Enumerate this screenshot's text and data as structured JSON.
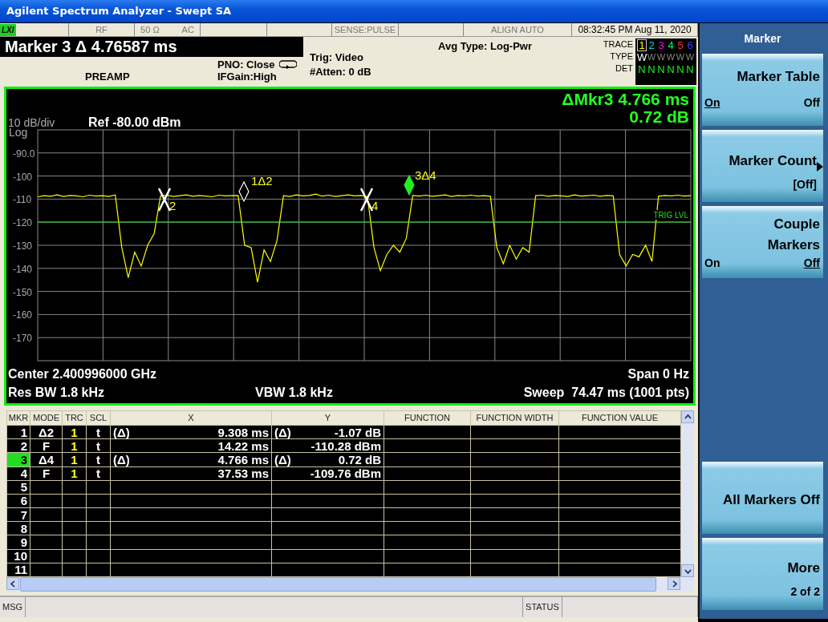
{
  "window": {
    "title": "Agilent Spectrum Analyzer - Swept SA"
  },
  "status_row": {
    "badge": "LXI",
    "rf": "RF",
    "impedance": "50 Ω",
    "coupling": "AC",
    "sense": "SENSE:PULSE",
    "align": "ALIGN AUTO",
    "datetime": "08:32:45 PM Aug 11, 2020"
  },
  "header": {
    "active_function": "Marker 3 Δ 4.76587 ms",
    "preamp": "PREAMP",
    "pno": "PNO: Close",
    "ifgain": "IFGain:High",
    "trig": "Trig: Video",
    "atten": "#Atten: 0 dB",
    "avg_type": "Avg Type: Log-Pwr"
  },
  "trace_panel": {
    "labels": [
      "TRACE",
      "TYPE",
      "DET"
    ],
    "traces": [
      {
        "number": "1",
        "color": "#ffff00",
        "selected": true,
        "type": "W",
        "det": "N"
      },
      {
        "number": "2",
        "color": "#00e0e0",
        "selected": false,
        "type": "W",
        "det": "N"
      },
      {
        "number": "3",
        "color": "#ff00ff",
        "selected": false,
        "type": "W",
        "det": "N"
      },
      {
        "number": "4",
        "color": "#00ff80",
        "selected": false,
        "type": "W",
        "det": "N"
      },
      {
        "number": "5",
        "color": "#ff3030",
        "selected": false,
        "type": "W",
        "det": "N"
      },
      {
        "number": "6",
        "color": "#4040ff",
        "selected": false,
        "type": "W",
        "det": "N"
      }
    ]
  },
  "graph": {
    "delta_readout": "ΔMkr3 4.766 ms",
    "delta_value": "0.72 dB",
    "scale": "10 dB/div",
    "ref": "Ref -80.00 dBm",
    "scale_type": "Log",
    "chart_data": {
      "type": "line",
      "grid": true,
      "ylim": [
        -180,
        -80
      ],
      "yticks": [
        {
          "value": -90,
          "label": "-90.0"
        },
        {
          "value": -100,
          "label": "-100"
        },
        {
          "value": -110,
          "label": "-110"
        },
        {
          "value": -120,
          "label": "-120"
        },
        {
          "value": -130,
          "label": "-130"
        },
        {
          "value": -140,
          "label": "-140"
        },
        {
          "value": -150,
          "label": "-150"
        },
        {
          "value": -160,
          "label": "-160"
        },
        {
          "value": -170,
          "label": "-170"
        }
      ],
      "series": [
        {
          "color": "#ffff00",
          "values": [
            -109,
            -108.5,
            -108.8,
            -108.2,
            -108.9,
            -108.4,
            -108.6,
            -109,
            -108.3,
            -108.7,
            -108.5,
            -108.9,
            -108.2,
            -131,
            -144,
            -133,
            -139,
            -130,
            -125,
            -108.6,
            -108.3,
            -108.9,
            -108.5,
            -108.2,
            -108.8,
            -108.4,
            -108.7,
            -109,
            -108.3,
            -108.6,
            -108.5,
            -108.4,
            -130,
            -131,
            -146,
            -132,
            -137,
            -128,
            -108.5,
            -108.9,
            -108.2,
            -108.6,
            -108.4,
            -107.8,
            -108.7,
            -108.3,
            -108.9,
            -108.5,
            -108.2,
            -108.6,
            -108.4,
            -109,
            -131,
            -141,
            -134,
            -130,
            -133,
            -127,
            -108.4,
            -108.7,
            -108.3,
            -108.8,
            -108.5,
            -108.2,
            -108.9,
            -108.4,
            -108.6,
            -108.3,
            -108.7,
            -108.5,
            -108.8,
            -131,
            -138,
            -130,
            -136,
            -131,
            -133,
            -108.5,
            -108.3,
            -108.8,
            -108.4,
            -108.6,
            -108.9,
            -108.2,
            -108.7,
            -108.5,
            -108.3,
            -108.8,
            -108.4,
            -108.6,
            -134,
            -139,
            -134,
            -135,
            -130,
            -137,
            -108.8,
            -108.4,
            -108.6,
            -108.3,
            -108.7,
            -108.5
          ]
        }
      ]
    },
    "trig_label": "TRIG LVL",
    "markers": [
      {
        "label": "2",
        "kind": "fixed",
        "selected": false
      },
      {
        "label": "1Δ2",
        "kind": "delta",
        "selected": false
      },
      {
        "label": "4",
        "kind": "fixed",
        "selected": false
      },
      {
        "label": "3Δ4",
        "kind": "delta",
        "selected": true
      }
    ],
    "center": "Center 2.400996000 GHz",
    "span": "Span 0 Hz",
    "rbw": "Res BW 1.8 kHz",
    "vbw": "VBW 1.8 kHz",
    "sweep": "Sweep  74.47 ms (1001 pts)"
  },
  "table": {
    "columns": [
      "MKR",
      "MODE",
      "TRC",
      "SCL",
      "X",
      "Y",
      "FUNCTION",
      "FUNCTION WIDTH",
      "FUNCTION VALUE"
    ],
    "rows": [
      {
        "mkr": "1",
        "mode": "Δ2",
        "trc": "1",
        "scl": "t",
        "x_ref": "(Δ)",
        "x": "9.308 ms",
        "y_ref": "(Δ)",
        "y": "-1.07 dB",
        "selected": false
      },
      {
        "mkr": "2",
        "mode": "F",
        "trc": "1",
        "scl": "t",
        "x": "14.22 ms",
        "y": "-110.28 dBm",
        "selected": false
      },
      {
        "mkr": "3",
        "mode": "Δ4",
        "trc": "1",
        "scl": "t",
        "x_ref": "(Δ)",
        "x": "4.766 ms",
        "y_ref": "(Δ)",
        "y": "0.72 dB",
        "selected": true
      },
      {
        "mkr": "4",
        "mode": "F",
        "trc": "1",
        "scl": "t",
        "x": "37.53 ms",
        "y": "-109.76 dBm",
        "selected": false
      },
      {
        "mkr": "5",
        "selected": false
      },
      {
        "mkr": "6",
        "selected": false
      },
      {
        "mkr": "7",
        "selected": false
      },
      {
        "mkr": "8",
        "selected": false
      },
      {
        "mkr": "9",
        "selected": false
      },
      {
        "mkr": "10",
        "selected": false
      },
      {
        "mkr": "11",
        "selected": false
      }
    ]
  },
  "message_bar": {
    "msg": "MSG",
    "status": "STATUS"
  },
  "softkeys": {
    "title": "Marker",
    "keys": [
      {
        "kind": "toggle",
        "label": "Marker Table",
        "options": [
          {
            "text": "On",
            "selected": true
          },
          {
            "text": "Off",
            "selected": false
          }
        ]
      },
      {
        "kind": "submenu",
        "label": "Marker Count",
        "value": "[Off]"
      },
      {
        "kind": "toggle",
        "label": "Couple Markers",
        "options": [
          {
            "text": "On",
            "selected": false
          },
          {
            "text": "Off",
            "selected": true
          }
        ]
      },
      {
        "kind": "action",
        "label": "All Markers Off"
      },
      {
        "kind": "more",
        "label": "More",
        "value": "2 of 2"
      }
    ]
  }
}
